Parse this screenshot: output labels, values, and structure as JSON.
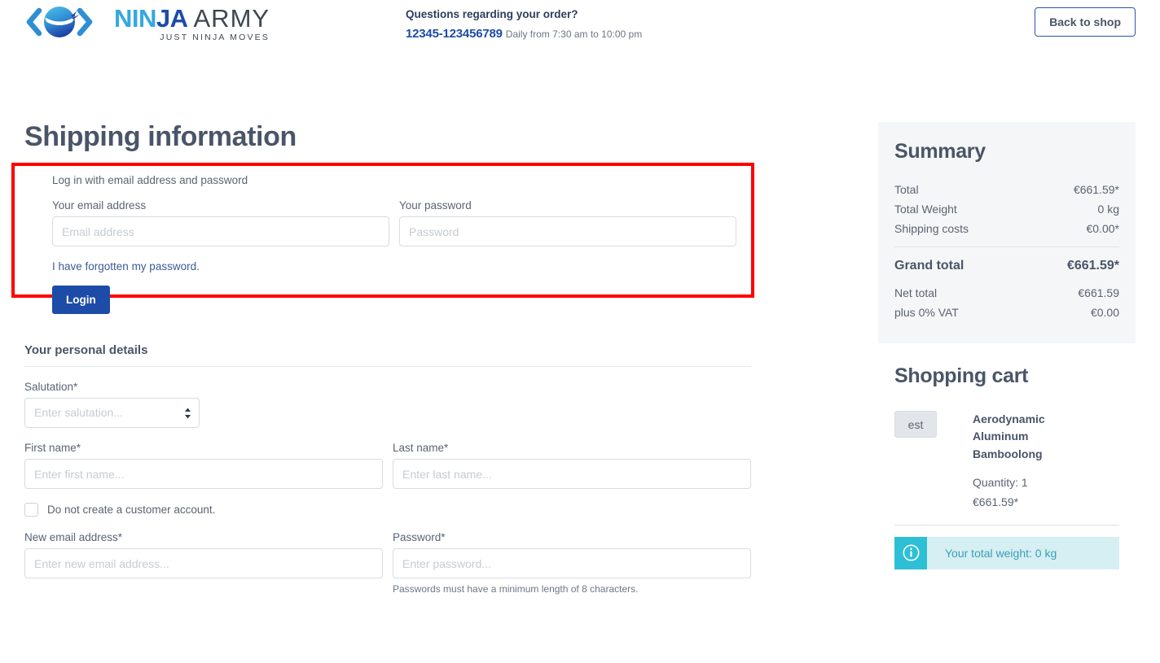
{
  "header": {
    "logo": {
      "icon_name": "ninja-head-logo",
      "word_part1": "NIN",
      "word_part2": "JA",
      "word_part3": "ARMY",
      "tagline": "JUST NINJA MOVES"
    },
    "contact": {
      "title": "Questions regarding your order?",
      "phone": "12345-123456789",
      "hours": "Daily from 7:30 am to 10:00 pm"
    },
    "back_to_shop_label": "Back to shop"
  },
  "main": {
    "page_title": "Shipping information",
    "login": {
      "hint": "Log in with email address and password",
      "email_label": "Your email address",
      "email_placeholder": "Email address",
      "email_value": "",
      "password_label": "Your password",
      "password_placeholder": "Password",
      "password_value": "",
      "forgot_link": "I have forgotten my password.",
      "login_button": "Login",
      "highlight_color": "#ff0000"
    },
    "personal": {
      "section_title": "Your personal details",
      "salutation_label": "Salutation*",
      "salutation_placeholder": "Enter salutation...",
      "salutation_value": "",
      "first_name_label": "First name*",
      "first_name_placeholder": "Enter first name...",
      "first_name_value": "",
      "last_name_label": "Last name*",
      "last_name_placeholder": "Enter last name...",
      "last_name_value": "",
      "no_account_label": "Do not create a customer account.",
      "no_account_checked": false,
      "new_email_label": "New email address*",
      "new_email_placeholder": "Enter new email address...",
      "new_email_value": "",
      "new_password_label": "Password*",
      "new_password_placeholder": "Enter password...",
      "new_password_value": "",
      "password_help": "Passwords must have a minimum length of 8 characters."
    }
  },
  "summary": {
    "title": "Summary",
    "rows": [
      {
        "label": "Total",
        "value": "€661.59*"
      },
      {
        "label": "Total Weight",
        "value": "0 kg"
      },
      {
        "label": "Shipping costs",
        "value": "€0.00*"
      }
    ],
    "grand_total_label": "Grand total",
    "grand_total_value": "€661.59*",
    "after_rows": [
      {
        "label": "Net total",
        "value": "€661.59"
      },
      {
        "label": "plus 0% VAT",
        "value": "€0.00"
      }
    ]
  },
  "cart": {
    "title": "Shopping cart",
    "item": {
      "thumb_text": "est",
      "name": "Aerodynamic Aluminum Bamboolong",
      "quantity": "Quantity: 1",
      "price": "€661.59*"
    },
    "alert": {
      "icon_name": "info-icon",
      "text": "Your total weight: 0 kg",
      "icon_bg": "#2cbfd6",
      "body_bg": "#d6eff3"
    }
  }
}
